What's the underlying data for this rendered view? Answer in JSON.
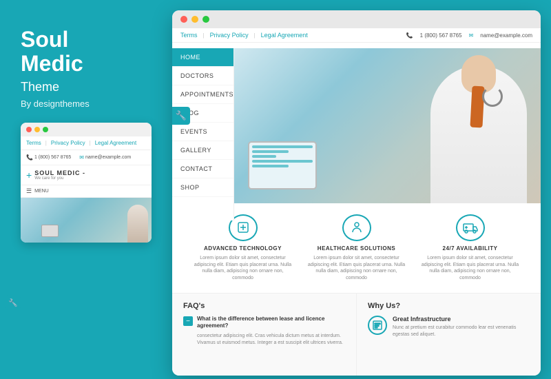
{
  "left": {
    "title_line1": "Soul",
    "title_line2": "Medic",
    "subtitle": "Theme",
    "byline": "By designthemes"
  },
  "mini_browser": {
    "nav_links": [
      "Terms",
      "Privacy Policy",
      "Legal Agreement"
    ],
    "phone": "1 (800) 567 8765",
    "email": "name@example.com",
    "logo_plus": "+",
    "logo_text": "SOUL MEDIC -",
    "logo_tagline": "We care for you",
    "menu_label": "MENU"
  },
  "main_browser": {
    "titlebar_dots": [
      "red",
      "yellow",
      "green"
    ],
    "nav_links": [
      "Terms",
      "Privacy Policy",
      "Legal Agreement"
    ],
    "phone": "1 (800) 567 8765",
    "email": "name@example.com",
    "nav_items": [
      {
        "label": "HOME",
        "active": true
      },
      {
        "label": "DOCTORS",
        "active": false
      },
      {
        "label": "APPOINTMENTS",
        "active": false
      },
      {
        "label": "BLOG",
        "active": false
      },
      {
        "label": "EVENTS",
        "active": false
      },
      {
        "label": "GALLERY",
        "active": false
      },
      {
        "label": "CONTACT",
        "active": false
      },
      {
        "label": "SHOP",
        "active": false
      }
    ]
  },
  "features": [
    {
      "icon": "⊕",
      "title": "ADVANCED TECHNOLOGY",
      "desc": "Lorem ipsum dolor sit amet, consectetur adipiscing elit. Etiam quis placerat urna. Nulla nulla diam, adipiscing non ornare non, commodo"
    },
    {
      "icon": "👤",
      "title": "HEALTHCARE SOLUTIONS",
      "desc": "Lorem ipsum dolor sit amet, consectetur adipiscing elit. Etiam quis placerat urna. Nulla nulla diam, adipiscing non ornare non, commodo"
    },
    {
      "icon": "🚑",
      "title": "24/7 AVAILABILITY",
      "desc": "Lorem ipsum dolor sit amet, consectetur adipiscing elit. Etiam quis placerat urna. Nulla nulla diam, adipiscing non ornare non, commodo"
    }
  ],
  "faq": {
    "title": "FAQ's",
    "question": "What is the difference between lease and licence agreement?",
    "answer": "consectetur adipiscing elit. Cras vehicula dictum metus at interdum. Vivamus ut euismod metus. Integer a est suscipit elit ultrices viverra."
  },
  "why": {
    "title": "Why Us?",
    "item_title": "Great Infrastructure",
    "item_text": "Nunc at pretium est curabitur commodo lear est venenatis egestas sed aliquet."
  },
  "colors": {
    "accent": "#18a7b5",
    "white": "#ffffff",
    "text_dark": "#333333",
    "text_muted": "#888888"
  }
}
